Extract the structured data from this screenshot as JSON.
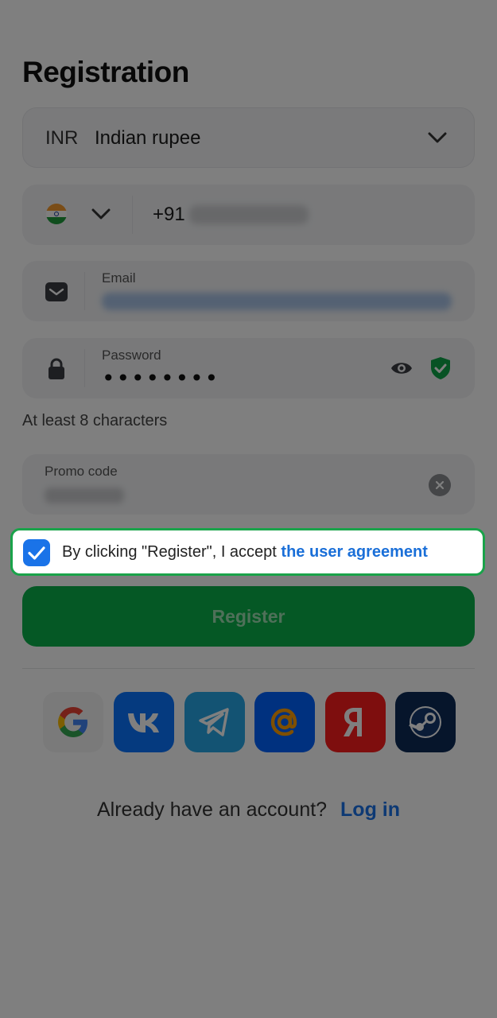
{
  "title": "Registration",
  "currency": {
    "code": "INR",
    "name": "Indian rupee"
  },
  "phone": {
    "prefix": "+91"
  },
  "email": {
    "label": "Email"
  },
  "password": {
    "label": "Password",
    "value": "••••••••"
  },
  "password_hint": "At least 8 characters",
  "promo": {
    "label": "Promo code"
  },
  "agreement": {
    "text": "By clicking \"Register\", I accept ",
    "link": "the user agreement",
    "checked": true
  },
  "register_button": "Register",
  "socials": [
    {
      "icon": "google-icon",
      "color": "#ffffff"
    },
    {
      "icon": "vk-icon",
      "color": "#0a74ff"
    },
    {
      "icon": "telegram-icon",
      "color": "#26a6e6"
    },
    {
      "icon": "mailru-icon",
      "color": "#0062ff"
    },
    {
      "icon": "yandex-icon",
      "color": "#fc1d1d"
    },
    {
      "icon": "steam-icon",
      "color": "#0d2a57"
    }
  ],
  "login": {
    "question": "Already have an account?",
    "link": "Log in"
  },
  "colors": {
    "accent": "#1a73e8",
    "primary_green": "#0bb14a",
    "highlight_border": "#1aa34a"
  }
}
